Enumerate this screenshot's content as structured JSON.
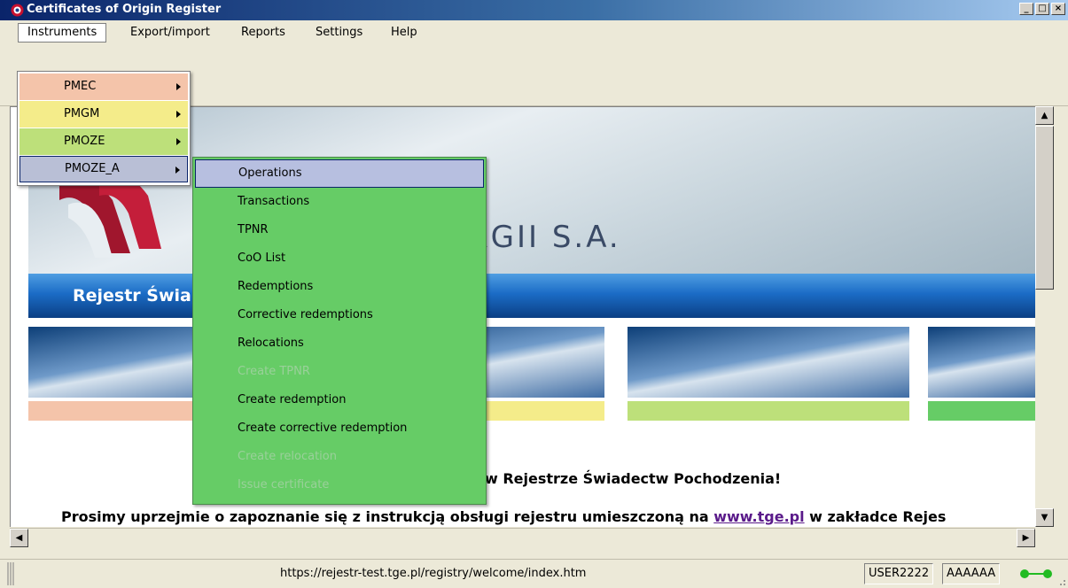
{
  "window": {
    "title": "Certificates of Origin Register",
    "controls": {
      "minimize": "_",
      "maximize": "□",
      "close": "×"
    }
  },
  "menubar": {
    "items": [
      "Instruments",
      "Export/import",
      "Reports",
      "Settings",
      "Help"
    ]
  },
  "instruments_menu": {
    "items": [
      {
        "label": "PMEC",
        "color": "#f4c4aa"
      },
      {
        "label": "PMGM",
        "color": "#f4ec8a"
      },
      {
        "label": "PMOZE",
        "color": "#bde07a"
      },
      {
        "label": "PMOZE_A",
        "color": "#b9bfd6"
      }
    ]
  },
  "submenu": {
    "items": [
      {
        "label": "Operations",
        "enabled": true
      },
      {
        "label": "Transactions",
        "enabled": true
      },
      {
        "label": "TPNR",
        "enabled": true
      },
      {
        "label": "CoO List",
        "enabled": true
      },
      {
        "label": "Redemptions",
        "enabled": true
      },
      {
        "label": "Corrective redemptions",
        "enabled": true
      },
      {
        "label": "Relocations",
        "enabled": true
      },
      {
        "label": "Create TPNR",
        "enabled": false
      },
      {
        "label": "Create redemption",
        "enabled": true
      },
      {
        "label": "Create corrective redemption",
        "enabled": true
      },
      {
        "label": "Create relocation",
        "enabled": false
      },
      {
        "label": "Issue certificate",
        "enabled": false
      }
    ]
  },
  "page": {
    "brand_fragment": "RGII S.A.",
    "banner_title": "Rejestr Świa",
    "welcome_text": "w Rejestrze Świadectw Pochodzenia!",
    "info_prefix": "Prosimy uprzejmie o zapoznanie się z instrukcją obsługi rejestru umieszczoną na ",
    "info_link": "www.tge.pl",
    "info_suffix": " w zakładce Rejes",
    "color_strips": [
      "#f4c4aa",
      "#f4ec8a",
      "#bde07a",
      "#66cc66"
    ]
  },
  "statusbar": {
    "url": "https://rejestr-test.tge.pl/registry/welcome/index.htm",
    "user": "USER2222",
    "account": "AAAAAA",
    "connection_color": "#22bb22"
  }
}
